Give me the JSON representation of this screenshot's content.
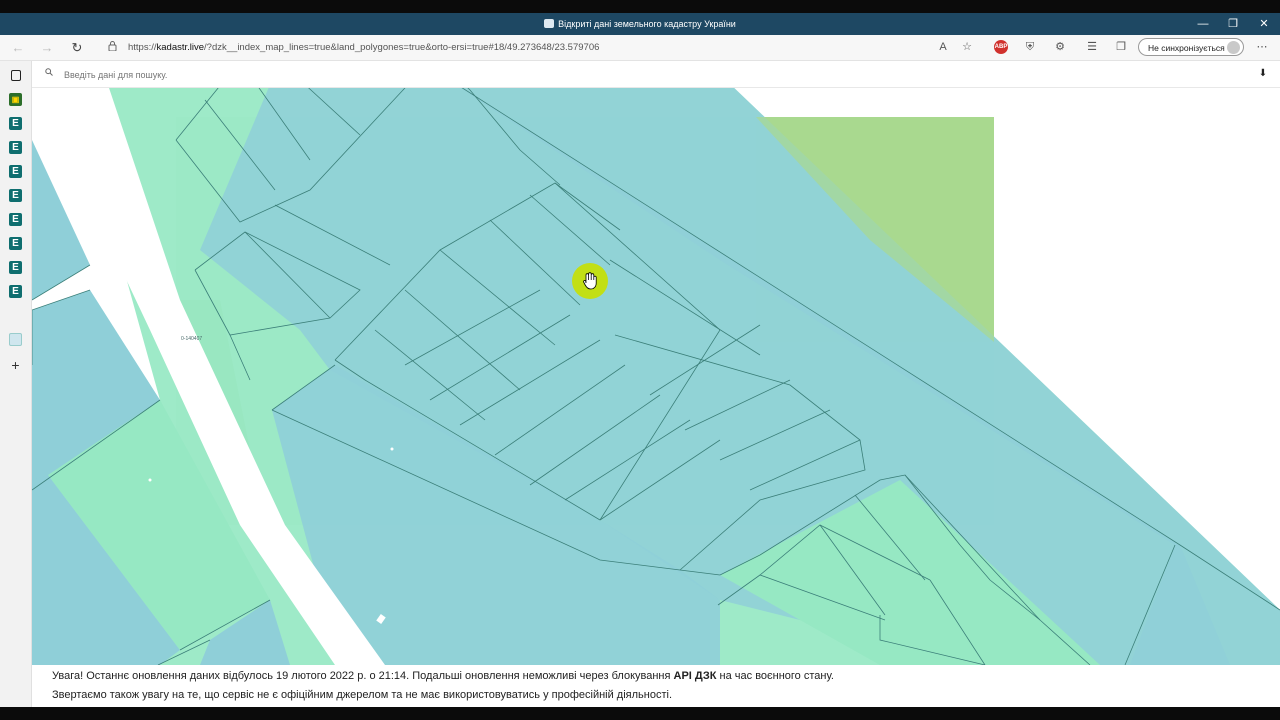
{
  "window": {
    "title": "Відкриті дані земельного кадастру України",
    "controls": [
      "—",
      "❐",
      "✕"
    ]
  },
  "browser": {
    "url_prefix": "https://",
    "url_host": "kadastr.live",
    "url_path": "/?dzk__index_map_lines=true&land_polygones=true&orto-ersi=true#18/49.273648/23.579706",
    "profile_label": "Не синхронізується",
    "adblock_label": "ABP"
  },
  "sidebar": {
    "items": [
      {
        "icon": "tabs-icon"
      },
      {
        "icon": "app-icon"
      },
      {
        "label": "E"
      },
      {
        "label": "E"
      },
      {
        "label": "E"
      },
      {
        "label": "E"
      },
      {
        "label": "E"
      },
      {
        "label": "E"
      },
      {
        "label": "E"
      },
      {
        "label": "E"
      },
      {
        "icon": "kadastr-icon"
      },
      {
        "icon": "plus-icon"
      }
    ]
  },
  "search": {
    "placeholder": "Введіть дані для пошуку."
  },
  "map": {
    "parcel_label": "0-140407",
    "colors": {
      "blue_parcel": "#8fcfd8",
      "green_parcel": "#96e8c3",
      "ortho_field": "#a9d98f",
      "road": "#ffffff",
      "cursor_highlight": "#c8e000"
    }
  },
  "notice": {
    "line1_a": "Увага! Останнє оновлення даних відбулось 19 лютого 2022 р. о 21:14. Подальші оновлення неможливі через блокування ",
    "line1_bold": "API ДЗК",
    "line1_b": " на час воєнного стану.",
    "line2": "Звертаємо також увагу на те, що сервіс не є офіційним джерелом та не має використовуватись у професійній діяльності."
  }
}
